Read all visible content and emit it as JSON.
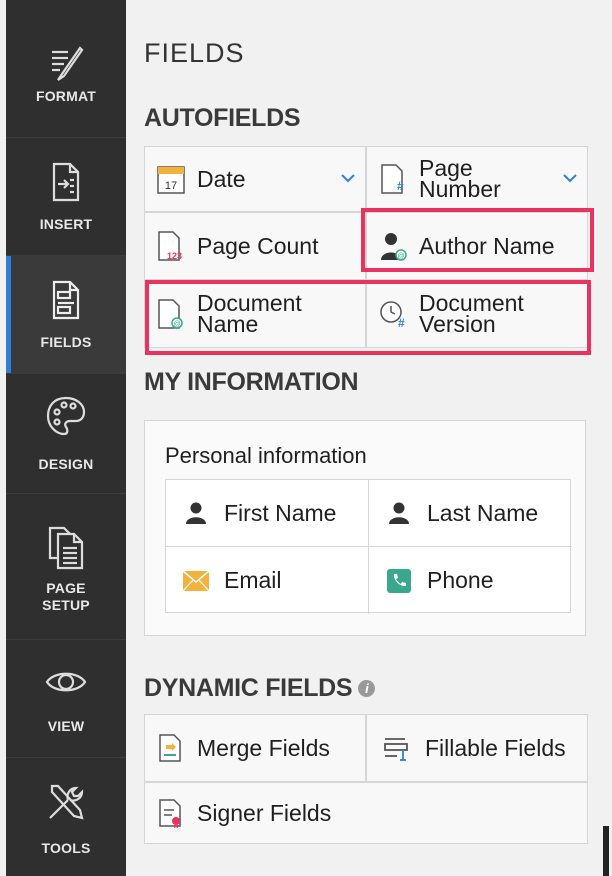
{
  "sidebar": {
    "items": [
      {
        "label": "FORMAT",
        "icon": "format-brush-icon"
      },
      {
        "label": "INSERT",
        "icon": "insert-page-icon"
      },
      {
        "label": "FIELDS",
        "icon": "fields-doc-icon",
        "active": true
      },
      {
        "label": "DESIGN",
        "icon": "palette-icon"
      },
      {
        "label": "PAGE\nSETUP",
        "icon": "page-setup-icon"
      },
      {
        "label": "VIEW",
        "icon": "eye-icon"
      },
      {
        "label": "TOOLS",
        "icon": "tools-icon"
      }
    ]
  },
  "panel": {
    "title": "FIELDS",
    "autofields": {
      "heading": "AUTOFIELDS",
      "date": "Date",
      "page_number": "Page\nNumber",
      "page_count": "Page Count",
      "author_name": "Author Name",
      "document_name": "Document\nName",
      "document_version": "Document\nVersion"
    },
    "my_information": {
      "heading": "MY INFORMATION",
      "card_title": "Personal information",
      "first_name": "First Name",
      "last_name": "Last Name",
      "email": "Email",
      "phone": "Phone"
    },
    "dynamic_fields": {
      "heading": "DYNAMIC FIELDS",
      "merge_fields": "Merge Fields",
      "fillable_fields": "Fillable Fields",
      "signer_fields": "Signer Fields"
    }
  },
  "colors": {
    "rail_bg": "#2f2f2f",
    "active_accent": "#2f7fd6",
    "highlight": "#e6335f",
    "email_icon": "#f2b23c",
    "phone_icon": "#3aa88d"
  }
}
